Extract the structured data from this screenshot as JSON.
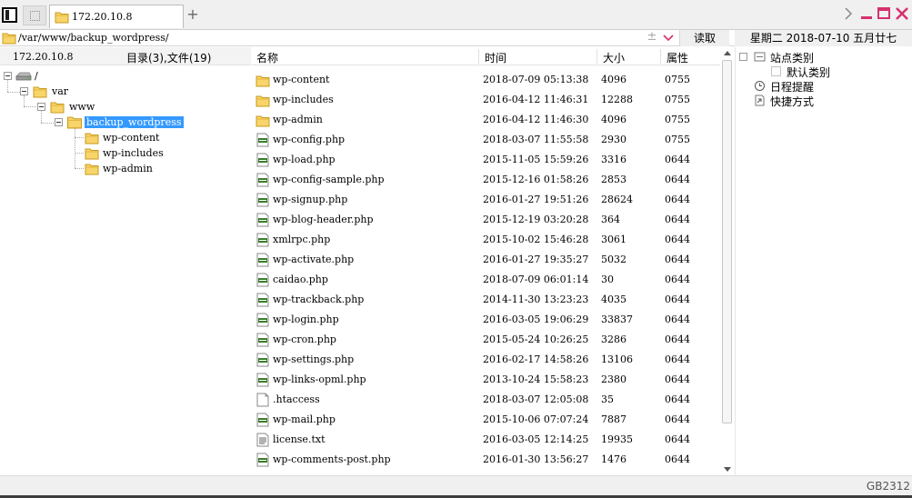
{
  "tabbar": {
    "tab_title": "172.20.10.8",
    "add_tab_symbol": "+"
  },
  "address": {
    "path": "/var/www/backup_wordpress/",
    "add_symbol": "±",
    "read_label": "读取"
  },
  "date_header": "星期二 2018-07-10 五月廿七",
  "info": {
    "host": "172.20.10.8",
    "counts": "目录(3),文件(19)"
  },
  "tree": {
    "root": "/",
    "var": "var",
    "www": "www",
    "backup": "backup_wordpress",
    "children": [
      "wp-content",
      "wp-includes",
      "wp-admin"
    ]
  },
  "columns": {
    "name": "名称",
    "time": "时间",
    "size": "大小",
    "perm": "属性"
  },
  "files": [
    {
      "type": "folder",
      "name": "wp-content",
      "time": "2018-07-09 05:13:38",
      "size": "4096",
      "perm": "0755"
    },
    {
      "type": "folder",
      "name": "wp-includes",
      "time": "2016-04-12 11:46:31",
      "size": "12288",
      "perm": "0755"
    },
    {
      "type": "folder",
      "name": "wp-admin",
      "time": "2016-04-12 11:46:30",
      "size": "4096",
      "perm": "0755"
    },
    {
      "type": "php",
      "name": "wp-config.php",
      "time": "2018-03-07 11:55:58",
      "size": "2930",
      "perm": "0755"
    },
    {
      "type": "php",
      "name": "wp-load.php",
      "time": "2015-11-05 15:59:26",
      "size": "3316",
      "perm": "0644"
    },
    {
      "type": "php",
      "name": "wp-config-sample.php",
      "time": "2015-12-16 01:58:26",
      "size": "2853",
      "perm": "0644"
    },
    {
      "type": "php",
      "name": "wp-signup.php",
      "time": "2016-01-27 19:51:26",
      "size": "28624",
      "perm": "0644"
    },
    {
      "type": "php",
      "name": "wp-blog-header.php",
      "time": "2015-12-19 03:20:28",
      "size": "364",
      "perm": "0644"
    },
    {
      "type": "php",
      "name": "xmlrpc.php",
      "time": "2015-10-02 15:46:28",
      "size": "3061",
      "perm": "0644"
    },
    {
      "type": "php",
      "name": "wp-activate.php",
      "time": "2016-01-27 19:35:27",
      "size": "5032",
      "perm": "0644"
    },
    {
      "type": "php",
      "name": "caidao.php",
      "time": "2018-07-09 06:01:14",
      "size": "30",
      "perm": "0644"
    },
    {
      "type": "php",
      "name": "wp-trackback.php",
      "time": "2014-11-30 13:23:23",
      "size": "4035",
      "perm": "0644"
    },
    {
      "type": "php",
      "name": "wp-login.php",
      "time": "2016-03-05 19:06:29",
      "size": "33837",
      "perm": "0644"
    },
    {
      "type": "php",
      "name": "wp-cron.php",
      "time": "2015-05-24 10:26:25",
      "size": "3286",
      "perm": "0644"
    },
    {
      "type": "php",
      "name": "wp-settings.php",
      "time": "2016-02-17 14:58:26",
      "size": "13106",
      "perm": "0644"
    },
    {
      "type": "php",
      "name": "wp-links-opml.php",
      "time": "2013-10-24 15:58:23",
      "size": "2380",
      "perm": "0644"
    },
    {
      "type": "file",
      "name": ".htaccess",
      "time": "2018-03-07 12:05:08",
      "size": "35",
      "perm": "0644"
    },
    {
      "type": "php",
      "name": "wp-mail.php",
      "time": "2015-10-06 07:07:24",
      "size": "7887",
      "perm": "0644"
    },
    {
      "type": "text",
      "name": "license.txt",
      "time": "2016-03-05 12:14:25",
      "size": "19935",
      "perm": "0644"
    },
    {
      "type": "php",
      "name": "wp-comments-post.php",
      "time": "2016-01-30 13:56:27",
      "size": "1476",
      "perm": "0644"
    }
  ],
  "right_panel": {
    "site_category": "站点类别",
    "default_category": "默认类别",
    "schedule": "日程提醒",
    "shortcuts": "快捷方式"
  },
  "footer": {
    "encoding": "GB2312"
  },
  "colors": {
    "selection": "#3399ff",
    "folder": "#f2c14e",
    "php_green": "#3a7d2c"
  }
}
